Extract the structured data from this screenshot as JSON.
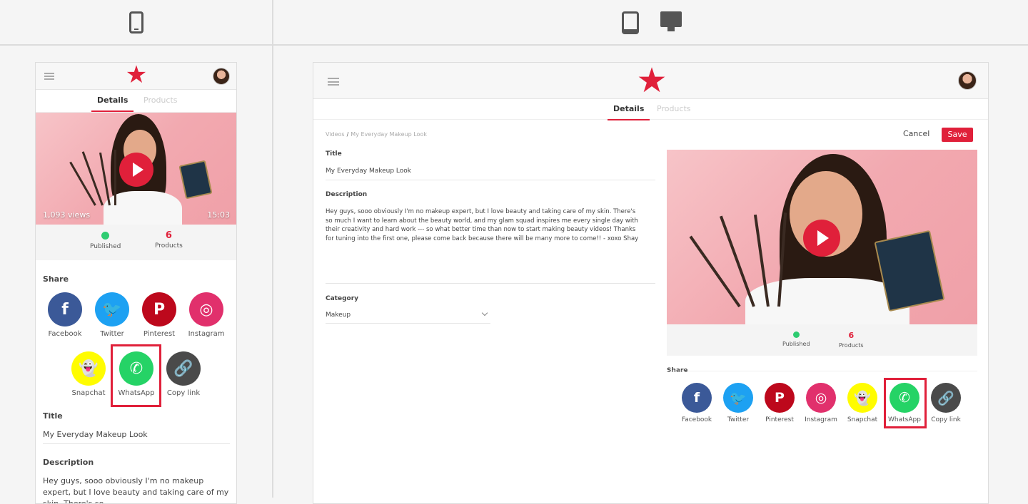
{
  "mobile": {
    "tabs": [
      "Details",
      "Products"
    ],
    "video": {
      "views": "1,093 views",
      "duration": "15:03"
    },
    "stats": {
      "published_label": "Published",
      "products_count": "6",
      "products_label": "Products"
    },
    "share_label": "Share",
    "share": [
      "Facebook",
      "Twitter",
      "Pinterest",
      "Instagram",
      "Snapchat",
      "WhatsApp",
      "Copy link"
    ],
    "title_label": "Title",
    "title_value": "My Everyday Makeup Look",
    "description_label": "Description",
    "description_value": "Hey guys, sooo obviously I'm no makeup expert, but I love beauty and taking care of my skin. There's so"
  },
  "tablet": {
    "tabs": [
      "Details",
      "Products"
    ],
    "breadcrumb": [
      "Videos",
      "/",
      "My Everyday Makeup Look"
    ],
    "cancel": "Cancel",
    "save": "Save",
    "title_label": "Title",
    "title_value": "My Everyday Makeup Look",
    "description_label": "Description",
    "description_value": "Hey guys, sooo obviously I'm no makeup expert, but I love beauty and taking care of my skin. There's so much I want to learn about the beauty world, and my glam squad inspires me every single day with their creativity and hard work --- so what better time than now to start making beauty videos! Thanks for tuning into the first one, please come back because there will be many more to come!! - xoxo Shay",
    "category_label": "Category",
    "category_value": "Makeup",
    "stats": {
      "published_label": "Published",
      "products_count": "6",
      "products_label": "Products"
    },
    "share_label": "Share",
    "share": [
      "Facebook",
      "Twitter",
      "Pinterest",
      "Instagram",
      "Snapchat",
      "WhatsApp",
      "Copy link"
    ]
  },
  "icons": {
    "facebook": "f",
    "twitter": "t",
    "pinterest": "p",
    "instagram": "camera",
    "snapchat": "ghost",
    "whatsapp": "phone",
    "copy-link": "link"
  },
  "colors": {
    "accent": "#e0203a",
    "published": "#2ecc71"
  }
}
